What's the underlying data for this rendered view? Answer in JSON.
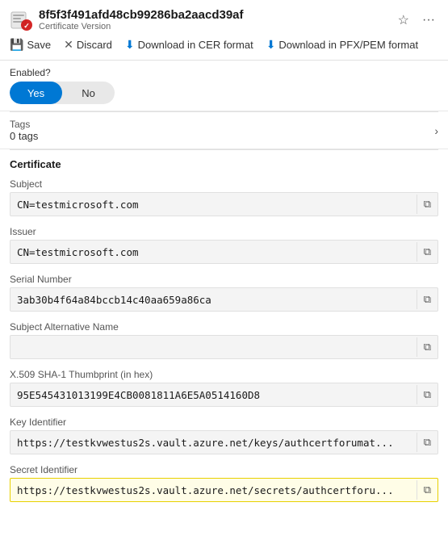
{
  "header": {
    "title": "8f5f3f491afd48cb99286ba2aacd39af",
    "subtitle": "Certificate Version",
    "pin_label": "Pin",
    "more_label": "More"
  },
  "toolbar": {
    "save_label": "Save",
    "discard_label": "Discard",
    "download_cer_label": "Download in CER format",
    "download_pfx_label": "Download in PFX/PEM format"
  },
  "enabled": {
    "label": "Enabled?",
    "yes_label": "Yes",
    "no_label": "No"
  },
  "tags": {
    "title": "Tags",
    "count": "0 tags"
  },
  "certificate_section": {
    "title": "Certificate",
    "fields": [
      {
        "label": "Subject",
        "value": "CN=testmicrosoft.com",
        "highlighted": false
      },
      {
        "label": "Issuer",
        "value": "CN=testmicrosoft.com",
        "highlighted": false
      },
      {
        "label": "Serial Number",
        "value": "3ab30b4f64a84bccb14c40aa659a86ca",
        "highlighted": false
      },
      {
        "label": "Subject Alternative Name",
        "value": "",
        "highlighted": false
      },
      {
        "label": "X.509 SHA-1 Thumbprint (in hex)",
        "value": "95E545431013199E4CB0081811A6E5A0514160D8",
        "highlighted": false
      },
      {
        "label": "Key Identifier",
        "value": "https://testkvwestus2s.vault.azure.net/keys/authcertforumat...",
        "highlighted": false
      },
      {
        "label": "Secret Identifier",
        "value": "https://testkvwestus2s.vault.azure.net/secrets/authcertforu...",
        "highlighted": true
      }
    ]
  },
  "icons": {
    "cert": "🏅",
    "save": "💾",
    "discard": "✕",
    "download": "⬇",
    "chevron_right": "›",
    "copy": "⧉",
    "pin": "☆",
    "more": "···"
  }
}
